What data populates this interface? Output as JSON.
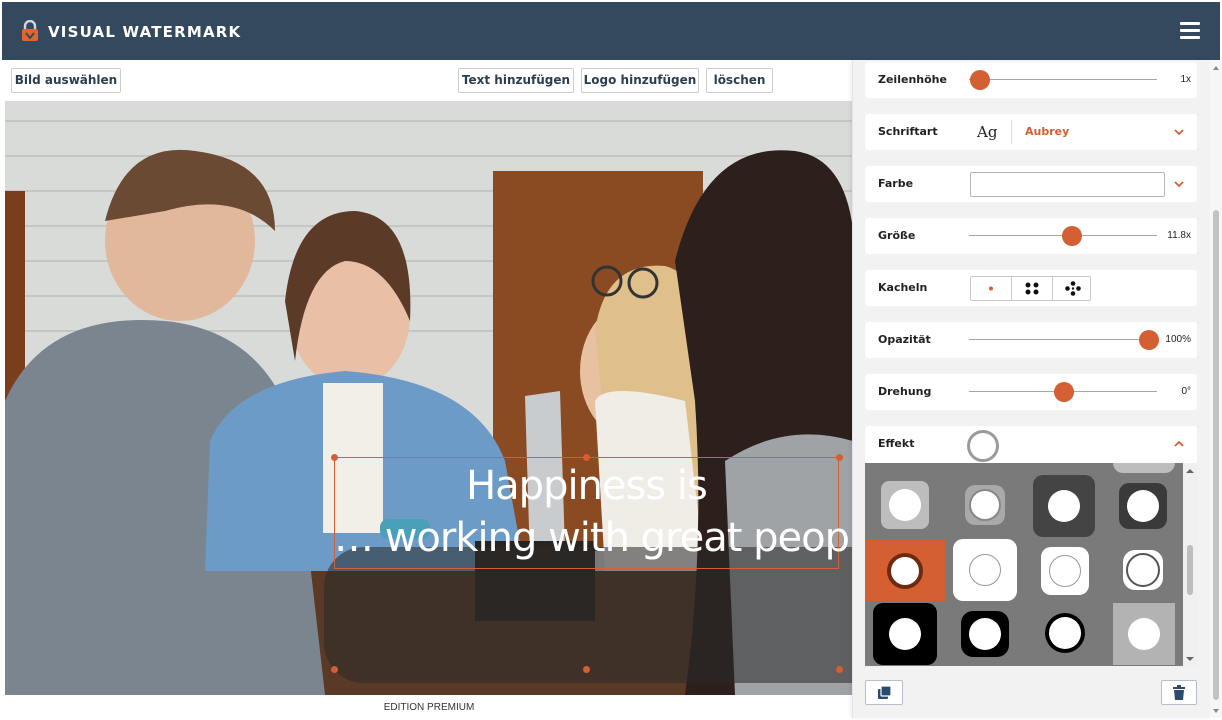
{
  "app": {
    "title": "VISUAL WATERMARK"
  },
  "toolbar": {
    "select_image": "Bild auswählen",
    "add_text": "Text hinzufügen",
    "add_logo": "Logo hinzufügen",
    "delete": "löschen"
  },
  "watermark": {
    "line1": "Happiness is",
    "line2": "… working with great people"
  },
  "footer": {
    "edition": "EDITION PREMIUM"
  },
  "panel": {
    "line_height": {
      "label": "Zeilenhöhe",
      "value": "1x",
      "level": 0.05
    },
    "font": {
      "label": "Schriftart",
      "preview": "Ag",
      "name": "Aubrey"
    },
    "color": {
      "label": "Farbe",
      "value": "#ffffff"
    },
    "size": {
      "label": "Größe",
      "value": "11.8x",
      "level": 0.55
    },
    "tiles": {
      "label": "Kacheln",
      "options": [
        "single",
        "four",
        "five"
      ],
      "selected": "single"
    },
    "opacity": {
      "label": "Opazität",
      "value": "100%",
      "level": 1.0
    },
    "rotation": {
      "label": "Drehung",
      "value": "0°",
      "level": 0.5
    },
    "effect": {
      "label": "Effekt",
      "selected_index": 4
    }
  },
  "colors": {
    "header": "#34495e",
    "accent": "#d35f33"
  },
  "icons": [
    "lock-logo-icon",
    "menu-icon",
    "chevron-down-icon",
    "chevron-up-icon",
    "duplicate-icon",
    "trash-icon"
  ]
}
